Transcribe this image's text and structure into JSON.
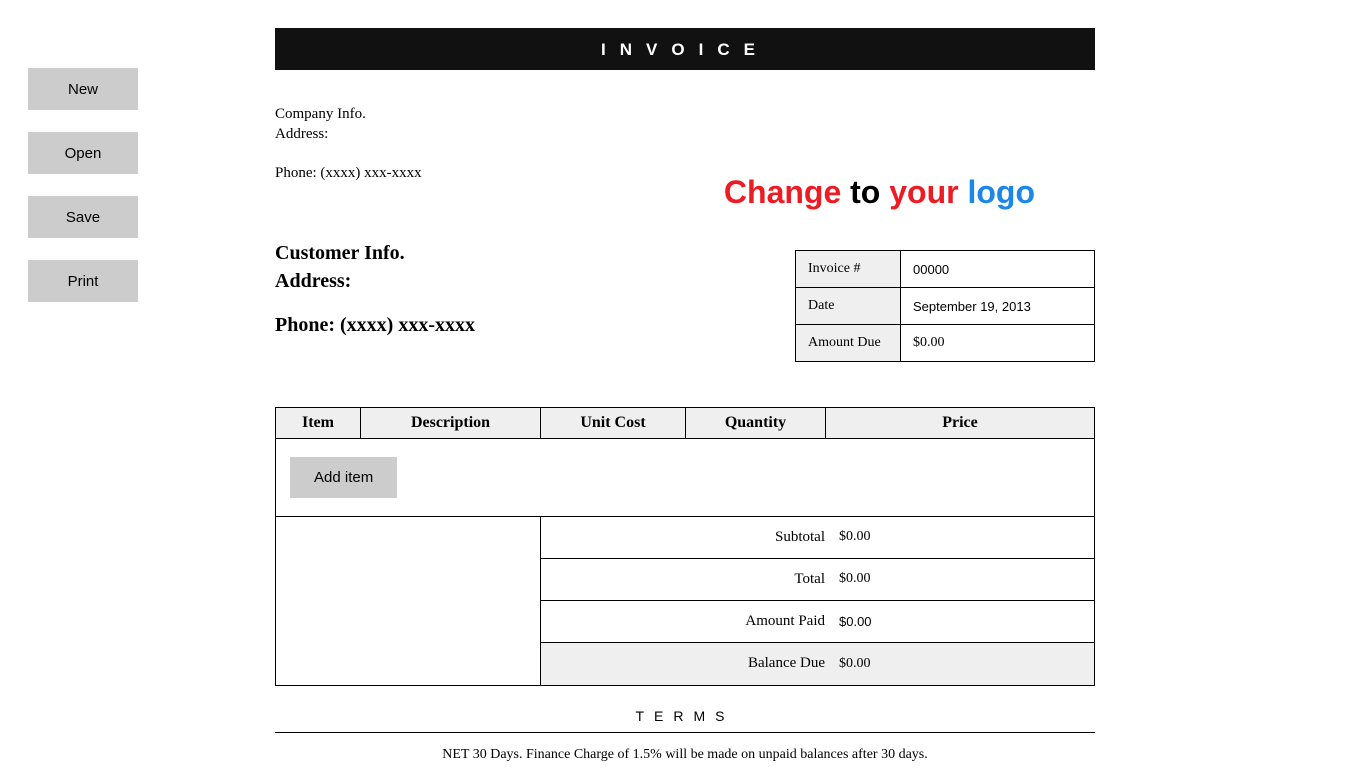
{
  "toolbar": {
    "new_label": "New",
    "open_label": "Open",
    "save_label": "Save",
    "print_label": "Print"
  },
  "header": {
    "title": "INVOICE"
  },
  "company": {
    "line1": "Company Info.",
    "line2": "Address:",
    "phone": "Phone: (xxxx) xxx-xxxx"
  },
  "logo": {
    "w1": "Change",
    "w2": "to",
    "w3": "your",
    "w4": "logo"
  },
  "meta": {
    "invoice_no_label": "Invoice #",
    "invoice_no_value": "00000",
    "date_label": "Date",
    "date_value": "September 19, 2013",
    "amount_due_label": "Amount Due",
    "amount_due_value": "$0.00"
  },
  "customer": {
    "line1": "Customer Info.",
    "line2": "Address:",
    "phone": "Phone: (xxxx) xxx-xxxx"
  },
  "items": {
    "headers": {
      "item": "Item",
      "description": "Description",
      "unit_cost": "Unit Cost",
      "quantity": "Quantity",
      "price": "Price"
    },
    "add_label": "Add item"
  },
  "totals": {
    "subtotal_label": "Subtotal",
    "subtotal_value": "$0.00",
    "total_label": "Total",
    "total_value": "$0.00",
    "amount_paid_label": "Amount Paid",
    "amount_paid_value": "$0.00",
    "balance_due_label": "Balance Due",
    "balance_due_value": "$0.00"
  },
  "terms": {
    "heading": "TERMS",
    "text": "NET 30 Days. Finance Charge of 1.5% will be made on unpaid balances after 30 days."
  }
}
